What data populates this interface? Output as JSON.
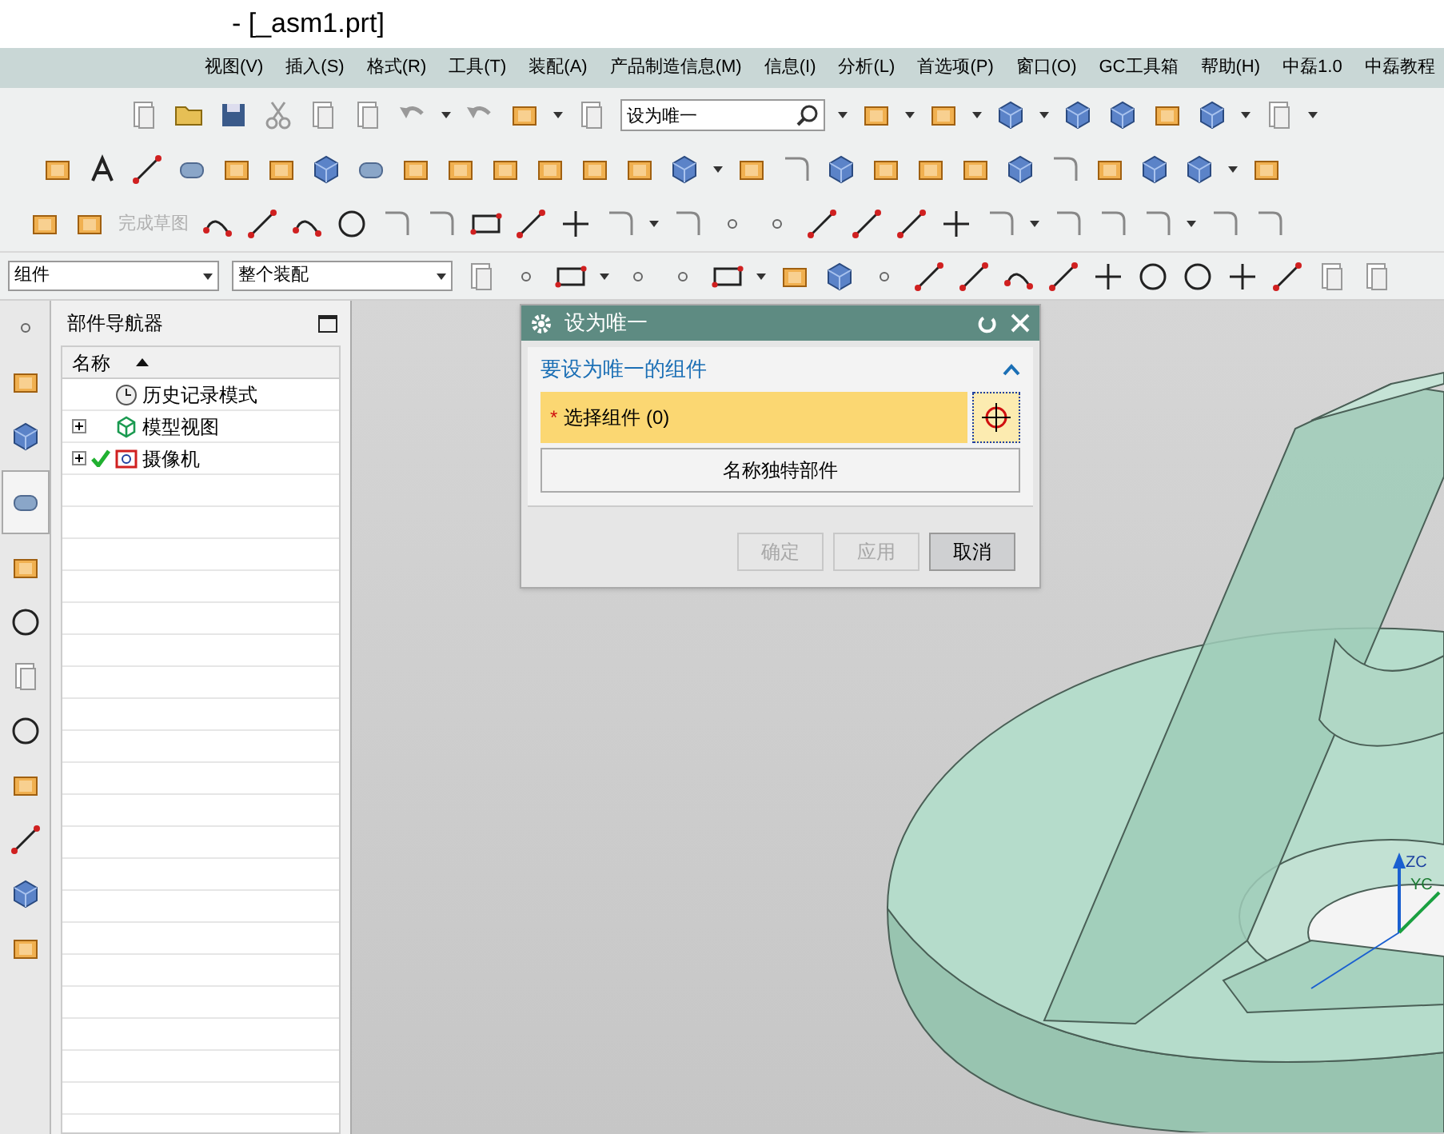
{
  "window": {
    "title": "- [_asm1.prt]"
  },
  "menu": [
    "视图(V)",
    "插入(S)",
    "格式(R)",
    "工具(T)",
    "装配(A)",
    "产品制造信息(M)",
    "信息(I)",
    "分析(L)",
    "首选项(P)",
    "窗口(O)",
    "GC工具箱",
    "帮助(H)",
    "中磊1.0",
    "中磊教程"
  ],
  "command_search": {
    "value": "设为唯一"
  },
  "sketch_toolbar": {
    "finish_label": "完成草图",
    "disabled": true
  },
  "selection_bar": {
    "filter": "组件",
    "scope": "整个装配"
  },
  "resource_tabs": [
    {
      "selected": false
    },
    {
      "selected": false
    },
    {
      "selected": false
    },
    {
      "selected": true
    },
    {
      "selected": false
    },
    {
      "selected": false
    },
    {
      "selected": false
    },
    {
      "selected": false
    },
    {
      "selected": false
    },
    {
      "selected": false
    },
    {
      "selected": false
    },
    {
      "selected": false
    }
  ],
  "navigator": {
    "title": "部件导航器",
    "column": "名称",
    "nodes": [
      {
        "label": "历史记录模式",
        "kind": "history"
      },
      {
        "label": "模型视图",
        "kind": "views",
        "expanded": false
      },
      {
        "label": "摄像机",
        "kind": "camera",
        "expanded": false,
        "checked": true
      }
    ]
  },
  "dialog": {
    "title": "设为唯一",
    "section": {
      "title": "要设为唯一的组件",
      "expanded": true,
      "required_mark": "*",
      "selection": "选择组件 (0)",
      "button": "名称独特部件"
    },
    "buttons": [
      {
        "label": "确定",
        "disabled": true
      },
      {
        "label": "应用",
        "disabled": true
      },
      {
        "label": "取消",
        "disabled": false
      }
    ]
  },
  "viewport": {
    "axis_labels": [
      "ZC",
      "YC"
    ]
  }
}
